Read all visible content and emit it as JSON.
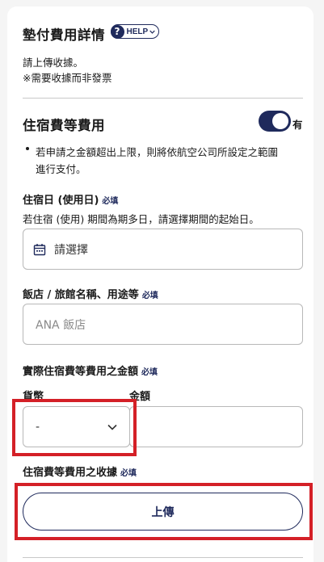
{
  "payment": {
    "title": "墊付費用詳情",
    "help_label": "HELP",
    "note_line1": "請上傳收據。",
    "note_line2": "※需要收據而非發票"
  },
  "lodging": {
    "title": "住宿費等費用",
    "toggle_label": "有",
    "toggle_on": true,
    "bullet": "若申請之金額超出上限，則將依航空公司所設定之範圍進行支付。",
    "date_label": "住宿日 (使用日)",
    "required": "必填",
    "date_hint": "若住宿 (使用) 期間為期多日，請選擇期間的起始日。",
    "date_value": "請選擇",
    "hotel_label": "飯店 / 旅館名稱、用途等",
    "hotel_placeholder": "ANA 飯店",
    "amount_label": "實際住宿費等費用之金額",
    "currency_label": "貨幣",
    "currency_value": "-",
    "amount_sublabel": "金額",
    "amount_value": "",
    "receipt_label": "住宿費等費用之收據",
    "upload_button": "上傳"
  },
  "colors": {
    "accent": "#1f2a5c",
    "highlight": "#d42027"
  }
}
